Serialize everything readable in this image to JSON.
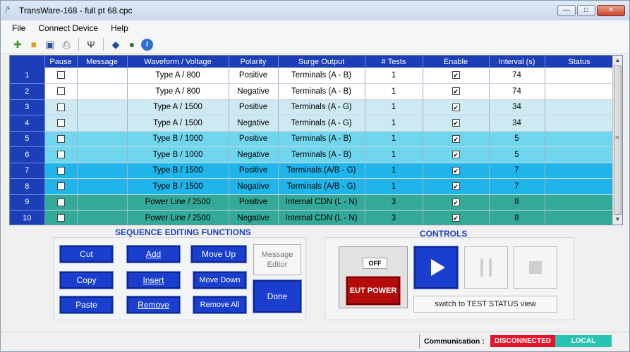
{
  "window": {
    "title": "TransWare-168 - full pt 68.cpc"
  },
  "menu": [
    "File",
    "Connect Device",
    "Help"
  ],
  "toolbar_icons": [
    "new-icon",
    "open-folder-icon",
    "save-icon",
    "print-icon",
    "usb-icon",
    "help-book-icon",
    "globe-icon",
    "info-icon"
  ],
  "grid": {
    "headers": [
      "",
      "Pause",
      "Message",
      "Waveform / Voltage",
      "Polarity",
      "Surge Output",
      "# Tests",
      "Enable",
      "Interval (s)",
      "Status"
    ],
    "rows": [
      {
        "num": "1",
        "pause": false,
        "message": "",
        "waveform": "Type A / 800",
        "polarity": "Positive",
        "output": "Terminals (A - B)",
        "tests": "1",
        "enable": true,
        "interval": "74",
        "status": "",
        "color": "#ffffff"
      },
      {
        "num": "2",
        "pause": false,
        "message": "",
        "waveform": "Type A / 800",
        "polarity": "Negative",
        "output": "Terminals (A - B)",
        "tests": "1",
        "enable": true,
        "interval": "74",
        "status": "",
        "color": "#ffffff"
      },
      {
        "num": "3",
        "pause": false,
        "message": "",
        "waveform": "Type A / 1500",
        "polarity": "Positive",
        "output": "Terminals (A - G)",
        "tests": "1",
        "enable": true,
        "interval": "34",
        "status": "",
        "color": "#cde9f2"
      },
      {
        "num": "4",
        "pause": false,
        "message": "",
        "waveform": "Type A / 1500",
        "polarity": "Negative",
        "output": "Terminals (A - G)",
        "tests": "1",
        "enable": true,
        "interval": "34",
        "status": "",
        "color": "#cde9f2"
      },
      {
        "num": "5",
        "pause": false,
        "message": "",
        "waveform": "Type B / 1000",
        "polarity": "Positive",
        "output": "Terminals (A - B)",
        "tests": "1",
        "enable": true,
        "interval": "5",
        "status": "",
        "color": "#6fd6ee"
      },
      {
        "num": "6",
        "pause": false,
        "message": "",
        "waveform": "Type B / 1000",
        "polarity": "Negative",
        "output": "Terminals (A - B)",
        "tests": "1",
        "enable": true,
        "interval": "5",
        "status": "",
        "color": "#6fd6ee"
      },
      {
        "num": "7",
        "pause": false,
        "message": "",
        "waveform": "Type B / 1500",
        "polarity": "Positive",
        "output": "Terminals (A/B - G)",
        "tests": "1",
        "enable": true,
        "interval": "7",
        "status": "",
        "color": "#1fb5ea"
      },
      {
        "num": "8",
        "pause": false,
        "message": "",
        "waveform": "Type B / 1500",
        "polarity": "Negative",
        "output": "Terminals (A/B - G)",
        "tests": "1",
        "enable": true,
        "interval": "7",
        "status": "",
        "color": "#1fb5ea"
      },
      {
        "num": "9",
        "pause": false,
        "message": "",
        "waveform": "Power Line / 2500",
        "polarity": "Positive",
        "output": "Internal CDN (L - N)",
        "tests": "3",
        "enable": true,
        "interval": "8",
        "status": "",
        "color": "#33a99a"
      },
      {
        "num": "10",
        "pause": false,
        "message": "",
        "waveform": "Power Line / 2500",
        "polarity": "Negative",
        "output": "Internal CDN (L - N)",
        "tests": "3",
        "enable": true,
        "interval": "8",
        "status": "",
        "color": "#33a99a"
      }
    ]
  },
  "sequence": {
    "title": "SEQUENCE EDITING FUNCTIONS",
    "cut": "Cut",
    "add": "Add",
    "move_up": "Move Up",
    "copy": "Copy",
    "insert": "Insert",
    "move_down": "Move Down",
    "paste": "Paste",
    "remove": "Remove",
    "remove_all": "Remove All",
    "message_editor": "Message Editor",
    "done": "Done"
  },
  "controls": {
    "title": "CONTROLS",
    "off": "OFF",
    "eut_power": "EUT POWER",
    "switch": "switch to TEST STATUS view"
  },
  "status": {
    "comm_label": "Communication :",
    "disconnected": "DISCONNECTED",
    "local": "LOCAL"
  }
}
